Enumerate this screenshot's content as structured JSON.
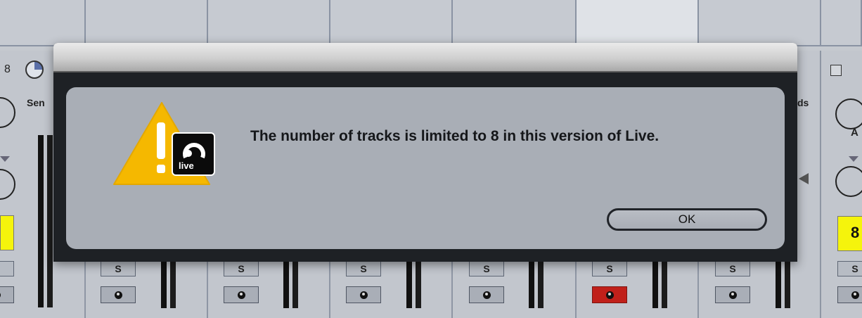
{
  "background": {
    "track_number": "8",
    "sends_label_left": "Sen",
    "sends_label_right": "ds",
    "right_yellow_value": "8",
    "solo_label": "S",
    "armed_track_index": 4
  },
  "dialog": {
    "message": "The number of tracks is limited to 8 in this version of Live.",
    "ok_label": "OK",
    "icon_badge_text": "live",
    "colors": {
      "warning_yellow": "#f5b800",
      "panel": "#a9aeb6",
      "frame": "#1e2125",
      "arm_red": "#c0201a"
    }
  },
  "icons": [
    "warning-triangle-icon",
    "live-logo-icon",
    "record-arm-icon",
    "pan-knob-icon",
    "track-activator-pie-icon"
  ]
}
